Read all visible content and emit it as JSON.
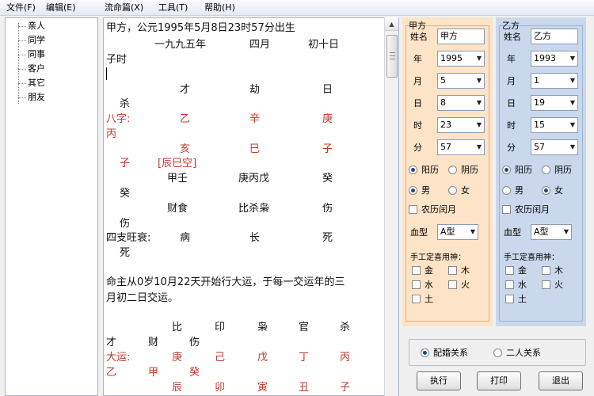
{
  "menu": [
    "文件(F)",
    "编辑(E)",
    "流命篇(X)",
    "工具(T)",
    "帮助(H)"
  ],
  "tree": [
    "亲人",
    "同学",
    "同事",
    "客户",
    "其它",
    "朋友"
  ],
  "text": {
    "line1": "甲方，公元1995年5月8日23时57分出生",
    "year_cn": "一九九五年",
    "month_cn": "四月",
    "day_cn": "初十日",
    "hour_cn": "子时",
    "gods_top": [
      "才",
      "劫",
      "日"
    ],
    "gods_top_tail": "杀",
    "bazi_label": "八字:",
    "stems": [
      "乙",
      "辛",
      "庚"
    ],
    "stem_extra": "丙",
    "branch_first": "子",
    "kongwang": "[辰巳空]",
    "branches": [
      "亥",
      "巳",
      "子"
    ],
    "hidden": [
      "甲壬",
      "庚丙戊",
      "癸"
    ],
    "hidden_extra": "癸",
    "hidden_gods": [
      "财食",
      "比杀枭",
      "伤"
    ],
    "hidden_gods_extra": "伤",
    "wangshuai_label": "四支旺衰:",
    "wangshuai": [
      "病",
      "长",
      "死"
    ],
    "wangshuai_extra": "死",
    "dayun_line1": "命主从0岁10月22天开始行大运，于每一交运年的三",
    "dayun_line2": "月初二日交运。",
    "luck_gods": [
      "比",
      "印",
      "枭",
      "官",
      "杀"
    ],
    "luck_gods_row2": [
      "才",
      "财",
      "伤"
    ],
    "dayun_label": "大运:",
    "luck_stems": [
      "庚",
      "己",
      "戊",
      "丁",
      "丙"
    ],
    "luck_row_b": [
      "乙",
      "甲",
      "癸"
    ],
    "luck_branches": [
      "辰",
      "卯",
      "寅",
      "丑",
      "子"
    ]
  },
  "panel_a": {
    "title": "甲方",
    "name_label": "姓名",
    "name_value": "甲方",
    "year_label": "年",
    "year": "1995",
    "month_label": "月",
    "month": "5",
    "day_label": "日",
    "day": "8",
    "hour_label": "时",
    "hour": "23",
    "minute_label": "分",
    "minute": "57",
    "solar": "阳历",
    "lunar": "阴历",
    "calendar": "solar",
    "male": "男",
    "female": "女",
    "gender": "male",
    "leap_label": "农历闰月",
    "blood_label": "血型",
    "blood_value": "A型",
    "manual_label": "手工定喜用神：",
    "elements": [
      "金",
      "木",
      "水",
      "火",
      "土"
    ]
  },
  "panel_b": {
    "title": "乙方",
    "name_label": "姓名",
    "name_value": "乙方",
    "year_label": "年",
    "year": "1993",
    "month_label": "月",
    "month": "1",
    "day_label": "日",
    "day": "19",
    "hour_label": "时",
    "hour": "15",
    "minute_label": "分",
    "minute": "57",
    "solar": "阳历",
    "lunar": "阴历",
    "calendar": "solar",
    "male": "男",
    "female": "女",
    "gender": "female",
    "leap_label": "农历闰月",
    "blood_label": "血型",
    "blood_value": "A型",
    "manual_label": "手工定喜用神：",
    "elements": [
      "金",
      "木",
      "水",
      "火",
      "土"
    ]
  },
  "relation": {
    "match": "配婚关系",
    "pair": "二人关系",
    "selected": "match"
  },
  "buttons": {
    "run": "执行",
    "print": "打印",
    "exit": "退出"
  }
}
